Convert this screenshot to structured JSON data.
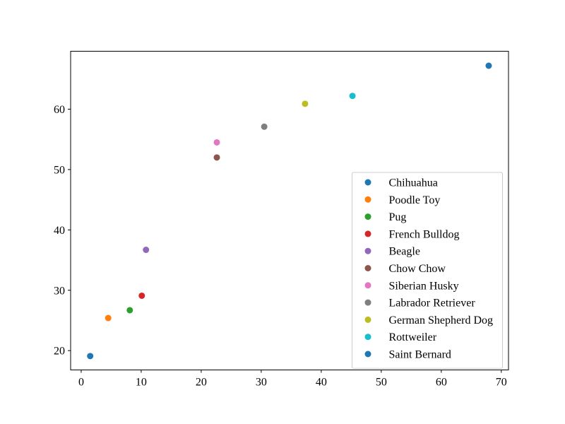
{
  "chart_data": {
    "type": "scatter",
    "title": "",
    "xlabel": "",
    "ylabel": "",
    "xlim": [
      -1.76,
      71.2
    ],
    "ylim": [
      16.8,
      69.6
    ],
    "xticks": [
      0,
      10,
      20,
      30,
      40,
      50,
      60,
      70
    ],
    "yticks": [
      20,
      30,
      40,
      50,
      60
    ],
    "xtick_labels": [
      "0",
      "10",
      "20",
      "30",
      "40",
      "50",
      "60",
      "70"
    ],
    "ytick_labels": [
      "20",
      "30",
      "40",
      "50",
      "60"
    ],
    "grid": false,
    "legend_position": "lower-right",
    "series": [
      {
        "name": "Chihuahua",
        "color": "#1f77b4",
        "x": 1.5,
        "y": 19.1
      },
      {
        "name": "Poodle Toy",
        "color": "#ff7f0e",
        "x": 4.5,
        "y": 25.4
      },
      {
        "name": "Pug",
        "color": "#2ca02c",
        "x": 8.1,
        "y": 26.7
      },
      {
        "name": "French Bulldog",
        "color": "#d62728",
        "x": 10.1,
        "y": 29.1
      },
      {
        "name": "Beagle",
        "color": "#9467bd",
        "x": 10.8,
        "y": 36.7
      },
      {
        "name": "Chow Chow",
        "color": "#8c564b",
        "x": 22.6,
        "y": 52.0
      },
      {
        "name": "Siberian Husky",
        "color": "#e377c2",
        "x": 22.6,
        "y": 54.5
      },
      {
        "name": "Labrador Retriever",
        "color": "#7f7f7f",
        "x": 30.5,
        "y": 57.1
      },
      {
        "name": "German Shepherd Dog",
        "color": "#bcbd22",
        "x": 37.3,
        "y": 60.9
      },
      {
        "name": "Rottweiler",
        "color": "#17becf",
        "x": 45.2,
        "y": 62.2
      },
      {
        "name": "Saint Bernard",
        "color": "#1f77b4",
        "x": 67.9,
        "y": 67.2
      }
    ]
  }
}
